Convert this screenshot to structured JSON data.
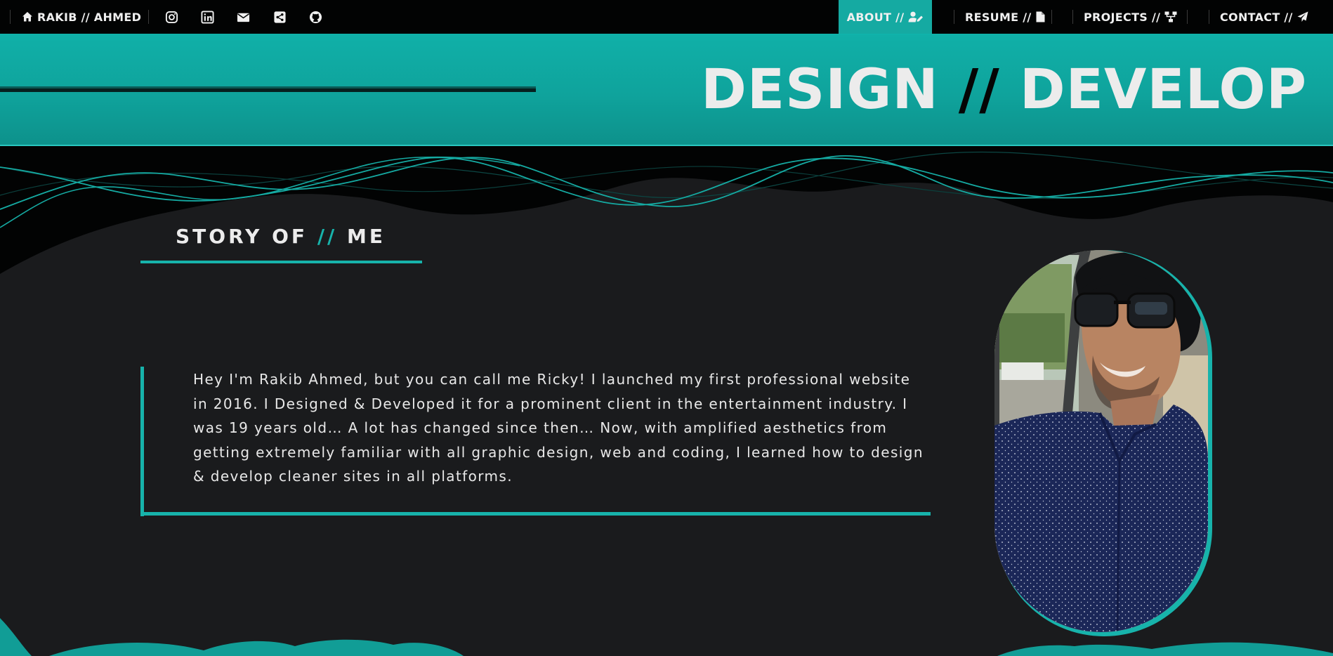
{
  "nav": {
    "brand": "RAKIB // AHMED",
    "social_icons": [
      "instagram-icon",
      "linkedin-icon",
      "mail-icon",
      "share-icon",
      "github-icon"
    ],
    "links": [
      {
        "label": "ABOUT //",
        "icon": "user-edit-icon",
        "active": true
      },
      {
        "label": "RESUME //",
        "icon": "file-icon",
        "active": false
      },
      {
        "label": "PROJECTS //",
        "icon": "sitemap-icon",
        "active": false
      },
      {
        "label": "CONTACT //",
        "icon": "paper-plane-icon",
        "active": false
      }
    ]
  },
  "hero": {
    "title_left": "DESIGN",
    "title_slash": "//",
    "title_right": "DEVELOP"
  },
  "story": {
    "heading_left": "STORY OF",
    "heading_slash": "//",
    "heading_right": "ME",
    "text": "Hey I'm Rakib Ahmed, but you can call me Ricky! I launched my first professional website in 2016. I Designed & Developed it for a prominent client in the entertainment industry. I was 19 years old… A lot has changed since then… Now, with amplified aesthetics from getting extremely familiar with all graphic design, web and coding, I learned how to design & develop cleaner sites in all platforms."
  },
  "colors": {
    "accent": "#17b3ab",
    "nav_background": "#020303",
    "page_background": "#1a1b1d",
    "text": "#e6e6e6"
  }
}
